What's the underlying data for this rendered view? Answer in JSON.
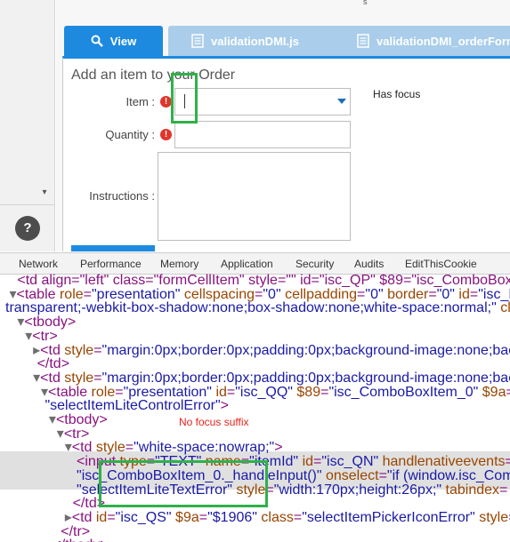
{
  "app": {
    "top_mark": "s",
    "help_label": "?",
    "scroll_down": "▾"
  },
  "tabs": [
    {
      "label": "View"
    },
    {
      "label": "validationDMI.js"
    },
    {
      "label": "validationDMI_orderForm"
    }
  ],
  "form": {
    "title": "Add an item to your Order",
    "item_label": "Item :",
    "quantity_label": "Quantity :",
    "instructions_label": "Instructions :",
    "error_glyph": "!",
    "item_value": "",
    "quantity_value": "",
    "instructions_value": ""
  },
  "annotations": {
    "has_focus": "Has focus",
    "no_focus_suffix": "No focus suffix",
    "highlight_color": "#2fb14a",
    "note_red": "#e8231a"
  },
  "devtools": {
    "tabs": [
      "Network",
      "Performance",
      "Memory",
      "Application",
      "Security",
      "Audits",
      "EditThisCookie"
    ],
    "lines": [
      {
        "indent": "   ",
        "parts": [
          [
            "t",
            "<td align=\"left\" class=\"formCellItem\" style=\"\" id=\"isc_QP\" $89=\"isc_ComboBoxItem_0\""
          ]
        ]
      },
      {
        "indent": " ",
        "parts": [
          [
            "r",
            "▾"
          ],
          [
            "t",
            "<table "
          ],
          [
            "a",
            "role"
          ],
          [
            "t",
            "="
          ],
          [
            "v",
            "\"presentation\""
          ],
          [
            "t",
            " "
          ],
          [
            "a",
            "cellspacing"
          ],
          [
            "t",
            "="
          ],
          [
            "v",
            "\"0\""
          ],
          [
            "t",
            " "
          ],
          [
            "a",
            "cellpadding"
          ],
          [
            "t",
            "="
          ],
          [
            "v",
            "\"0\""
          ],
          [
            "t",
            " "
          ],
          [
            "a",
            "border"
          ],
          [
            "t",
            "="
          ],
          [
            "v",
            "\"0\""
          ],
          [
            "t",
            " "
          ],
          [
            "a",
            "id"
          ],
          [
            "t",
            "="
          ],
          [
            "v",
            "\"isc_RB\""
          ],
          [
            "t",
            " s"
          ]
        ]
      },
      {
        "indent": "",
        "parts": [
          [
            "v",
            "transparent;-webkit-box-shadow:none;box-shadow:none;white-space:normal;\""
          ],
          [
            "t",
            " "
          ],
          [
            "a",
            "class"
          ],
          [
            "t",
            "="
          ],
          [
            "v",
            "\"form"
          ]
        ]
      },
      {
        "indent": "   ",
        "parts": [
          [
            "r",
            "▾"
          ],
          [
            "t",
            "<tbody>"
          ]
        ]
      },
      {
        "indent": "     ",
        "parts": [
          [
            "r",
            "▾"
          ],
          [
            "t",
            "<tr>"
          ]
        ]
      },
      {
        "indent": "       ",
        "parts": [
          [
            "r",
            "▸"
          ],
          [
            "t",
            "<td "
          ],
          [
            "a",
            "style"
          ],
          [
            "t",
            "="
          ],
          [
            "v",
            "\"margin:0px;border:0px;padding:0px;background-image:none;background"
          ]
        ]
      },
      {
        "indent": "        ",
        "parts": [
          [
            "t",
            "</td>"
          ]
        ]
      },
      {
        "indent": "       ",
        "parts": [
          [
            "r",
            "▾"
          ],
          [
            "t",
            "<td "
          ],
          [
            "a",
            "style"
          ],
          [
            "t",
            "="
          ],
          [
            "v",
            "\"margin:0px;border:0px;padding:0px;background-image:none;background"
          ]
        ]
      },
      {
        "indent": "         ",
        "parts": [
          [
            "r",
            "▾"
          ],
          [
            "t",
            "<table "
          ],
          [
            "a",
            "role"
          ],
          [
            "t",
            "="
          ],
          [
            "v",
            "\"presentation\""
          ],
          [
            "t",
            " "
          ],
          [
            "a",
            "id"
          ],
          [
            "t",
            "="
          ],
          [
            "v",
            "\"isc_QQ\""
          ],
          [
            "t",
            " "
          ],
          [
            "a",
            "$89"
          ],
          [
            "t",
            "="
          ],
          [
            "v",
            "\"isc_ComboBoxItem_0\""
          ],
          [
            "t",
            " "
          ],
          [
            "a",
            "$9a"
          ],
          [
            "t",
            "="
          ],
          [
            "v",
            "\"$9f\""
          ],
          [
            "t",
            " c"
          ]
        ]
      },
      {
        "indent": "          ",
        "parts": [
          [
            "v",
            "\"selectItemLiteControlError\""
          ],
          [
            "t",
            ">"
          ]
        ]
      },
      {
        "indent": "           ",
        "parts": [
          [
            "r",
            "▾"
          ],
          [
            "t",
            "<tbody>"
          ]
        ]
      },
      {
        "indent": "             ",
        "parts": [
          [
            "r",
            "▾"
          ],
          [
            "t",
            "<tr>"
          ]
        ]
      },
      {
        "indent": "               ",
        "parts": [
          [
            "r",
            "▾"
          ],
          [
            "t",
            "<td "
          ],
          [
            "a",
            "style"
          ],
          [
            "t",
            "="
          ],
          [
            "v",
            "\"white-space:nowrap;\""
          ],
          [
            "t",
            ">"
          ]
        ]
      },
      {
        "indent": "                  ",
        "parts": [
          [
            "t",
            "<input "
          ],
          [
            "a",
            "type"
          ],
          [
            "t",
            "="
          ],
          [
            "v",
            "\"TEXT\""
          ],
          [
            "t",
            " "
          ],
          [
            "a",
            "name"
          ],
          [
            "t",
            "="
          ],
          [
            "v",
            "\"itemId\""
          ],
          [
            "t",
            " "
          ],
          [
            "a",
            "id"
          ],
          [
            "t",
            "="
          ],
          [
            "v",
            "\"isc_QN\""
          ],
          [
            "t",
            " "
          ],
          [
            "a",
            "handlenativeevents"
          ],
          [
            "t",
            "="
          ],
          [
            "v",
            "\"fal"
          ]
        ]
      },
      {
        "indent": "                  ",
        "parts": [
          [
            "v",
            "\"isc_ComboBoxItem_0._handleInput()\""
          ],
          [
            "t",
            " "
          ],
          [
            "a",
            "onselect"
          ],
          [
            "t",
            "="
          ],
          [
            "v",
            "\"if (window.isc_ComboBo"
          ]
        ]
      },
      {
        "indent": "                  ",
        "parts": [
          [
            "v",
            "\"selectItemLiteTextError\""
          ],
          [
            "t",
            " "
          ],
          [
            "a",
            "style"
          ],
          [
            "t",
            "="
          ],
          [
            "v",
            "\"width:170px;height:26px;\""
          ],
          [
            "t",
            " "
          ],
          [
            "a",
            "tabindex"
          ],
          [
            "t",
            "="
          ]
        ]
      },
      {
        "indent": "                 ",
        "parts": [
          [
            "t",
            "</td>"
          ]
        ]
      },
      {
        "indent": "               ",
        "parts": [
          [
            "r",
            "▸"
          ],
          [
            "t",
            "<td "
          ],
          [
            "a",
            "id"
          ],
          [
            "t",
            "="
          ],
          [
            "v",
            "\"isc_QS\""
          ],
          [
            "t",
            " "
          ],
          [
            "a",
            "$9a"
          ],
          [
            "t",
            "="
          ],
          [
            "v",
            "\"$1906\""
          ],
          [
            "t",
            " "
          ],
          [
            "a",
            "class"
          ],
          [
            "t",
            "="
          ],
          [
            "v",
            "\"selectItemPickerIconError\""
          ],
          [
            "t",
            " "
          ],
          [
            "a",
            "style"
          ],
          [
            "t",
            "="
          ],
          [
            "v",
            "\"f"
          ]
        ]
      },
      {
        "indent": "              ",
        "parts": [
          [
            "t",
            "</tr>"
          ]
        ]
      },
      {
        "indent": "            ",
        "parts": [
          [
            "t",
            "</tbody>"
          ]
        ]
      }
    ]
  }
}
